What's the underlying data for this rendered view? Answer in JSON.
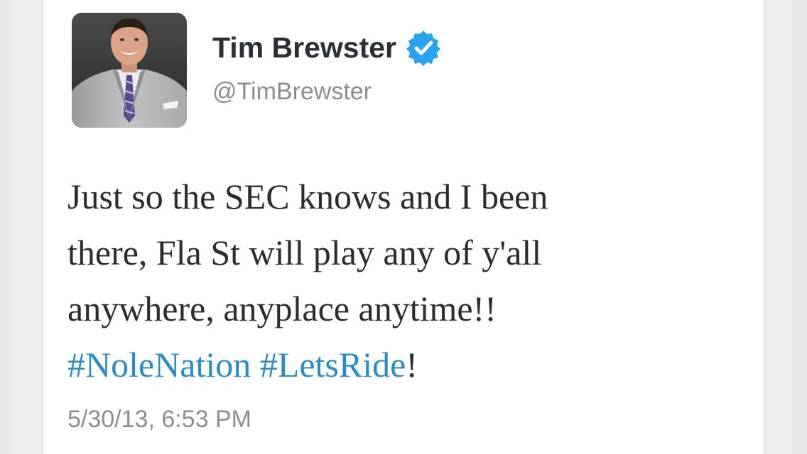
{
  "user": {
    "display_name": "Tim Brewster",
    "handle": "@TimBrewster",
    "verified": true,
    "verified_icon": "verified-badge-icon"
  },
  "tweet": {
    "lines": {
      "l1": "Just so the SEC knows and I been",
      "l2": "there, Fla St will play any of y'all",
      "l3": "anywhere, anyplace anytime!!"
    },
    "hashtags": [
      "#NoleNation",
      "#LetsRide"
    ],
    "trailing": "!",
    "timestamp": "5/30/13, 6:53 PM"
  },
  "colors": {
    "hashtag": "#2b8cc4",
    "verified_badge": "#2aa3ef",
    "text": "#2c2c2c",
    "muted": "#8a8f93"
  }
}
